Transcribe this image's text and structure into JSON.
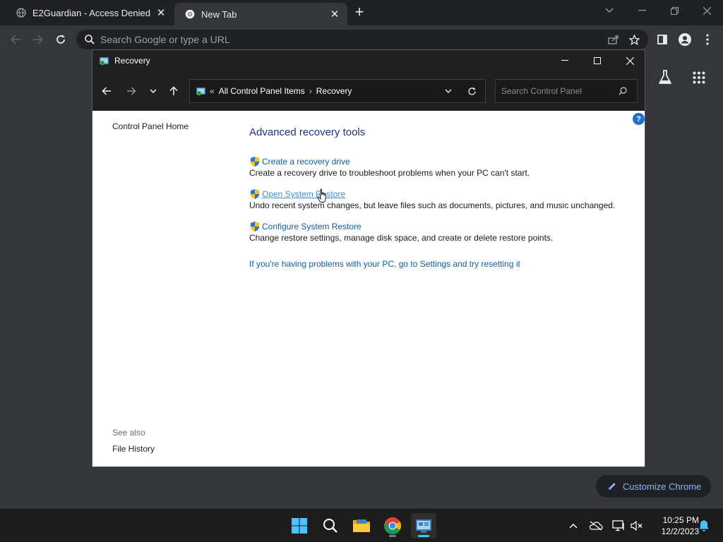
{
  "browser": {
    "tabs": [
      {
        "title": "E2Guardian - Access Denied",
        "active": false
      },
      {
        "title": "New Tab",
        "active": true
      }
    ],
    "omnibox_placeholder": "Search Google or type a URL",
    "customize_label": "Customize Chrome"
  },
  "window": {
    "title": "Recovery",
    "address": {
      "overflow": "«",
      "crumbs": [
        "All Control Panel Items",
        "Recovery"
      ]
    },
    "search_placeholder": "Search Control Panel"
  },
  "sidebar": {
    "home": "Control Panel Home",
    "see_also_label": "See also",
    "see_also_items": [
      "File History"
    ]
  },
  "main": {
    "heading": "Advanced recovery tools",
    "tools": [
      {
        "label": "Create a recovery drive",
        "description": "Create a recovery drive to troubleshoot problems when your PC can't start."
      },
      {
        "label": "Open System Restore",
        "description": "Undo recent system changes, but leave files such as documents, pictures, and music unchanged."
      },
      {
        "label": "Configure System Restore",
        "description": "Change restore settings, manage disk space, and create or delete restore points."
      }
    ],
    "reset_link": "If you're having problems with your PC, go to Settings and try resetting it"
  },
  "taskbar": {
    "time": "10:25 PM",
    "date": "12/2/2023"
  },
  "colors": {
    "link": "#0b5eb8",
    "heading": "#1e3287",
    "accent": "#4cc2ff"
  }
}
